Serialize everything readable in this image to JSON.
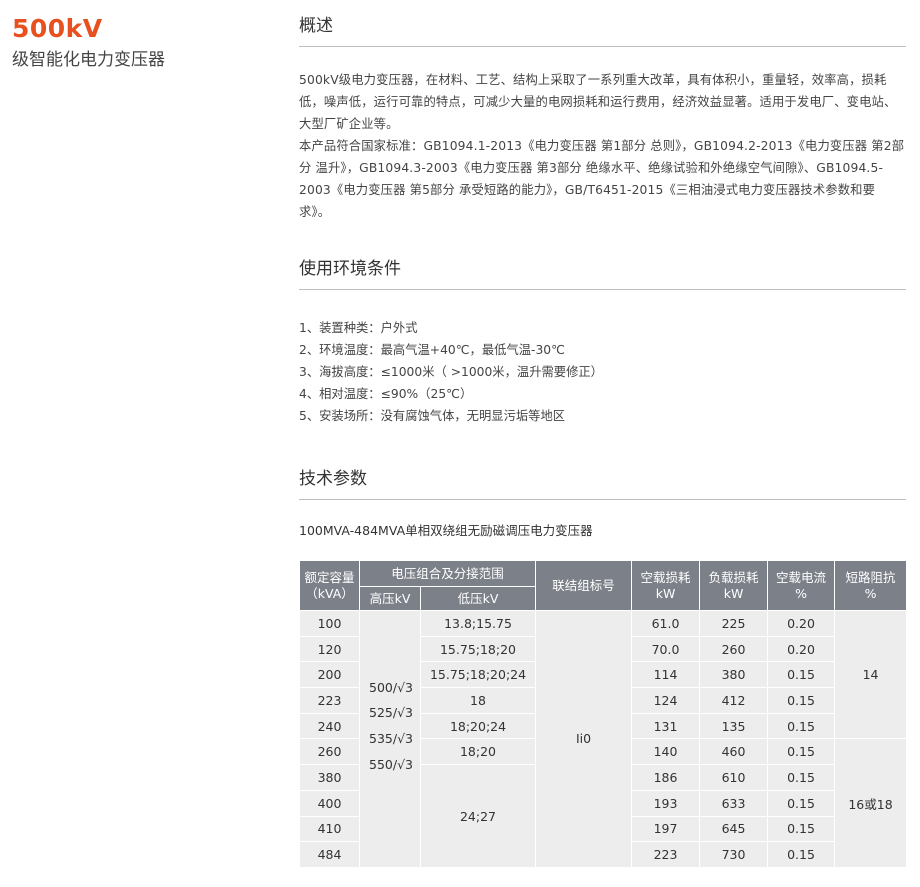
{
  "product": {
    "title": "500kV",
    "subtitle": "级智能化电力变压器"
  },
  "sections": {
    "overview": {
      "heading": "概述",
      "para1": "500kV级电力变压器，在材料、工艺、结构上采取了一系列重大改革，具有体积小，重量轻，效率高，损耗低，噪声低，运行可靠的特点，可减少大量的电网损耗和运行费用，经济效益显著。适用于发电厂、变电站、大型厂矿企业等。",
      "para2": "本产品符合国家标准：GB1094.1-2013《电力变压器 第1部分 总则》，GB1094.2-2013《电力变压器 第2部分 温升》，GB1094.3-2003《电力变压器 第3部分 绝缘水平、绝缘试验和外绝缘空气间隙》、GB1094.5-2003《电力变压器 第5部分 承受短路的能力》，GB/T6451-2015《三相油浸式电力变压器技术参数和要求》。"
    },
    "conditions": {
      "heading": "使用环境条件",
      "items": [
        "1、装置种类：户外式",
        "2、环境温度：最高气温+40℃，最低气温-30℃",
        "3、海拔高度：≤1000米（ >1000米，温升需要修正）",
        "4、相对温度：≤90%（25℃）",
        "5、安装场所：没有腐蚀气体，无明显污垢等地区"
      ]
    },
    "specs": {
      "heading": "技术参数",
      "caption": "100MVA-484MVA单相双绕组无励磁调压电力变压器"
    }
  },
  "table": {
    "headers": {
      "capacity": "额定容量\n（kVA）",
      "voltage_group": "电压组合及分接范围",
      "hv": "高压kV",
      "lv": "低压kV",
      "vector": "联结组标号",
      "noload_loss": "空载损耗\nkW",
      "load_loss": "负载损耗\nkW",
      "noload_current": "空载电流\n%",
      "impedance": "短路阻抗\n%"
    },
    "capacity": [
      "100",
      "120",
      "200",
      "223",
      "240",
      "260",
      "380",
      "400",
      "410",
      "484"
    ],
    "hv_values": [
      "500/√3",
      "525/√3",
      "535/√3",
      "550/√3"
    ],
    "lv_values": [
      "13.8;15.75",
      "15.75;18;20",
      "15.75;18;20;24",
      "18",
      "18;20;24",
      "18;20",
      "24;27"
    ],
    "vector_group": "Ii0",
    "noload_loss": [
      "61.0",
      "70.0",
      "114",
      "124",
      "131",
      "140",
      "186",
      "193",
      "197",
      "223"
    ],
    "load_loss": [
      "225",
      "260",
      "380",
      "412",
      "135",
      "460",
      "610",
      "633",
      "645",
      "730"
    ],
    "noload_current": [
      "0.20",
      "0.20",
      "0.15",
      "0.15",
      "0.15",
      "0.15",
      "0.15",
      "0.15",
      "0.15",
      "0.15"
    ],
    "impedance": [
      "14",
      "16或18"
    ]
  }
}
